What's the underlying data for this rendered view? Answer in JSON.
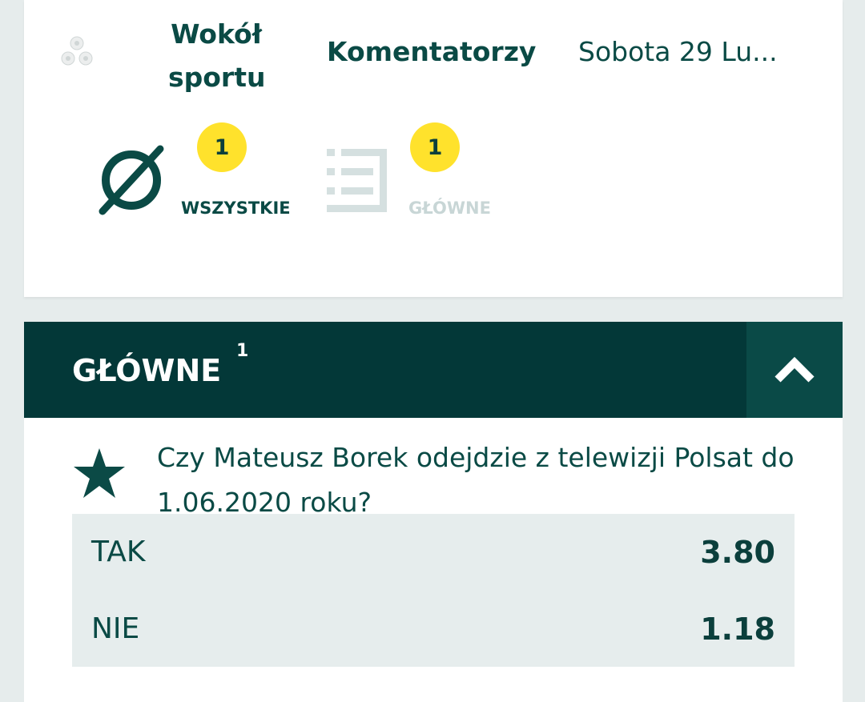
{
  "nav": {
    "items": [
      {
        "label": "Wokół sportu"
      },
      {
        "label": "Komentatorzy"
      },
      {
        "label": "Sobota 29 Lu..."
      }
    ],
    "icon": "sports-balls-icon"
  },
  "filters": [
    {
      "label": "WSZYSTKIE",
      "count": "1",
      "icon": "no-filter-icon",
      "active": true
    },
    {
      "label": "GŁÓWNE",
      "count": "1",
      "icon": "list-icon",
      "active": false
    }
  ],
  "section": {
    "title": "GŁÓWNE",
    "count": "1",
    "toggle_icon": "chevron-up-icon"
  },
  "market": {
    "question": "Czy Mateusz Borek odejdzie z telewizji Polsat do 1.06.2020 roku?",
    "favorite_icon": "star-icon",
    "outcomes": [
      {
        "label": "TAK",
        "odds": "3.80"
      },
      {
        "label": "NIE",
        "odds": "1.18"
      }
    ]
  },
  "colors": {
    "primary": "#0a4a45",
    "header_bg": "#033838",
    "badge": "#ffe22c",
    "odds_bg": "#e6eded",
    "page_bg": "#e6ecec",
    "inactive": "#c8d6d6"
  }
}
